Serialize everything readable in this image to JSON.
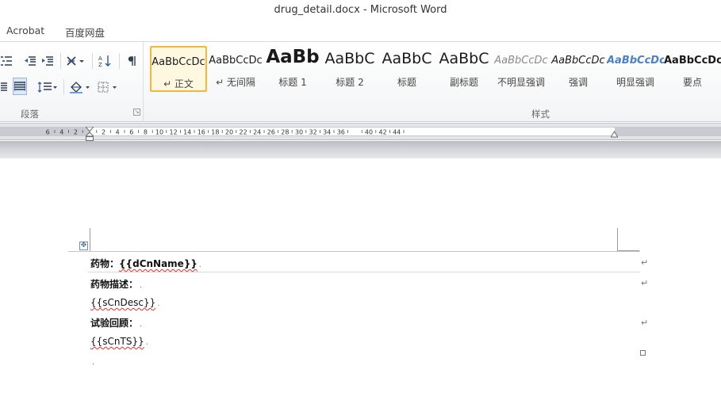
{
  "window": {
    "title": "drug_detail.docx  -  Microsoft Word"
  },
  "menubar": {
    "items": [
      "Acrobat",
      "百度网盘"
    ]
  },
  "ribbon": {
    "paragraph_group_label": "段落",
    "styles_group_label": "样式",
    "styles": [
      {
        "preview": "AaBbCcDc",
        "label": "↵ 正文"
      },
      {
        "preview": "AaBbCcDc",
        "label": "↵ 无间隔"
      },
      {
        "preview": "AaBb",
        "label": "标题 1"
      },
      {
        "preview": "AaBbC",
        "label": "标题 2"
      },
      {
        "preview": "AaBbC",
        "label": "标题"
      },
      {
        "preview": "AaBbC",
        "label": "副标题"
      },
      {
        "preview": "AaBbCcDc",
        "label": "不明显强调"
      },
      {
        "preview": "AaBbCcDc",
        "label": "强调"
      },
      {
        "preview": "AaBbCcDc",
        "label": "明显强调"
      },
      {
        "preview": "AaBbCcDc",
        "label": "要点"
      }
    ]
  },
  "ruler": {
    "labels": [
      "6",
      "4",
      "2",
      "2",
      "4",
      "6",
      "8",
      "10",
      "12",
      "14",
      "16",
      "18",
      "20",
      "22",
      "24",
      "26",
      "28",
      "30",
      "32",
      "34",
      "36",
      "40",
      "42",
      "44"
    ]
  },
  "document": {
    "drug_label": "药物：",
    "drug_field": "{{dCnName}}",
    "desc_label": "药物描述：",
    "desc_field": "{{sCnDesc}}",
    "trial_label": "试验回顾：",
    "trial_field": "{{sCnTS}}",
    "paragraph_mark": "↵"
  },
  "colors": {
    "selected_style_border": "#f2b73c",
    "spell_check_underline": "#e03030",
    "emphasis_style_text": "#4f81bd"
  }
}
